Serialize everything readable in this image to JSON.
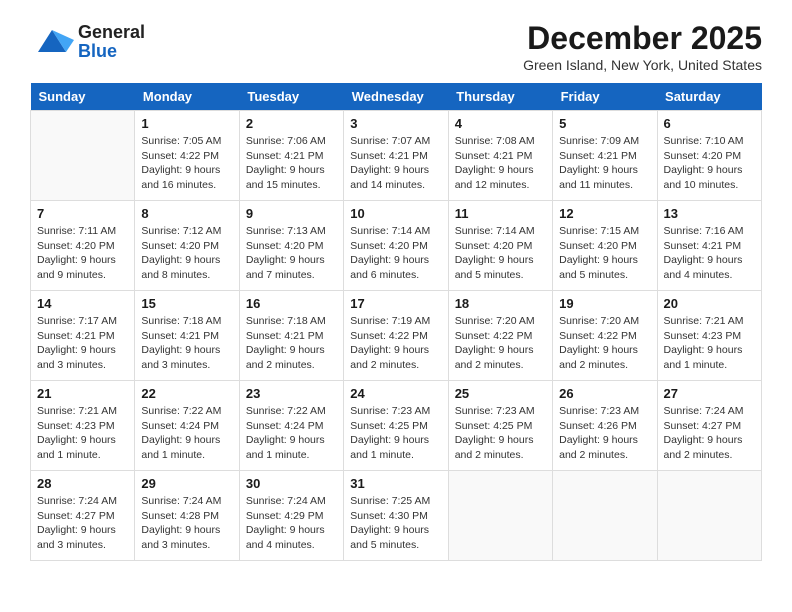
{
  "header": {
    "logo_general": "General",
    "logo_blue": "Blue",
    "month_title": "December 2025",
    "location": "Green Island, New York, United States"
  },
  "weekdays": [
    "Sunday",
    "Monday",
    "Tuesday",
    "Wednesday",
    "Thursday",
    "Friday",
    "Saturday"
  ],
  "weeks": [
    [
      {
        "day": "",
        "info": ""
      },
      {
        "day": "1",
        "info": "Sunrise: 7:05 AM\nSunset: 4:22 PM\nDaylight: 9 hours\nand 16 minutes."
      },
      {
        "day": "2",
        "info": "Sunrise: 7:06 AM\nSunset: 4:21 PM\nDaylight: 9 hours\nand 15 minutes."
      },
      {
        "day": "3",
        "info": "Sunrise: 7:07 AM\nSunset: 4:21 PM\nDaylight: 9 hours\nand 14 minutes."
      },
      {
        "day": "4",
        "info": "Sunrise: 7:08 AM\nSunset: 4:21 PM\nDaylight: 9 hours\nand 12 minutes."
      },
      {
        "day": "5",
        "info": "Sunrise: 7:09 AM\nSunset: 4:21 PM\nDaylight: 9 hours\nand 11 minutes."
      },
      {
        "day": "6",
        "info": "Sunrise: 7:10 AM\nSunset: 4:20 PM\nDaylight: 9 hours\nand 10 minutes."
      }
    ],
    [
      {
        "day": "7",
        "info": "Sunrise: 7:11 AM\nSunset: 4:20 PM\nDaylight: 9 hours\nand 9 minutes."
      },
      {
        "day": "8",
        "info": "Sunrise: 7:12 AM\nSunset: 4:20 PM\nDaylight: 9 hours\nand 8 minutes."
      },
      {
        "day": "9",
        "info": "Sunrise: 7:13 AM\nSunset: 4:20 PM\nDaylight: 9 hours\nand 7 minutes."
      },
      {
        "day": "10",
        "info": "Sunrise: 7:14 AM\nSunset: 4:20 PM\nDaylight: 9 hours\nand 6 minutes."
      },
      {
        "day": "11",
        "info": "Sunrise: 7:14 AM\nSunset: 4:20 PM\nDaylight: 9 hours\nand 5 minutes."
      },
      {
        "day": "12",
        "info": "Sunrise: 7:15 AM\nSunset: 4:20 PM\nDaylight: 9 hours\nand 5 minutes."
      },
      {
        "day": "13",
        "info": "Sunrise: 7:16 AM\nSunset: 4:21 PM\nDaylight: 9 hours\nand 4 minutes."
      }
    ],
    [
      {
        "day": "14",
        "info": "Sunrise: 7:17 AM\nSunset: 4:21 PM\nDaylight: 9 hours\nand 3 minutes."
      },
      {
        "day": "15",
        "info": "Sunrise: 7:18 AM\nSunset: 4:21 PM\nDaylight: 9 hours\nand 3 minutes."
      },
      {
        "day": "16",
        "info": "Sunrise: 7:18 AM\nSunset: 4:21 PM\nDaylight: 9 hours\nand 2 minutes."
      },
      {
        "day": "17",
        "info": "Sunrise: 7:19 AM\nSunset: 4:22 PM\nDaylight: 9 hours\nand 2 minutes."
      },
      {
        "day": "18",
        "info": "Sunrise: 7:20 AM\nSunset: 4:22 PM\nDaylight: 9 hours\nand 2 minutes."
      },
      {
        "day": "19",
        "info": "Sunrise: 7:20 AM\nSunset: 4:22 PM\nDaylight: 9 hours\nand 2 minutes."
      },
      {
        "day": "20",
        "info": "Sunrise: 7:21 AM\nSunset: 4:23 PM\nDaylight: 9 hours\nand 1 minute."
      }
    ],
    [
      {
        "day": "21",
        "info": "Sunrise: 7:21 AM\nSunset: 4:23 PM\nDaylight: 9 hours\nand 1 minute."
      },
      {
        "day": "22",
        "info": "Sunrise: 7:22 AM\nSunset: 4:24 PM\nDaylight: 9 hours\nand 1 minute."
      },
      {
        "day": "23",
        "info": "Sunrise: 7:22 AM\nSunset: 4:24 PM\nDaylight: 9 hours\nand 1 minute."
      },
      {
        "day": "24",
        "info": "Sunrise: 7:23 AM\nSunset: 4:25 PM\nDaylight: 9 hours\nand 1 minute."
      },
      {
        "day": "25",
        "info": "Sunrise: 7:23 AM\nSunset: 4:25 PM\nDaylight: 9 hours\nand 2 minutes."
      },
      {
        "day": "26",
        "info": "Sunrise: 7:23 AM\nSunset: 4:26 PM\nDaylight: 9 hours\nand 2 minutes."
      },
      {
        "day": "27",
        "info": "Sunrise: 7:24 AM\nSunset: 4:27 PM\nDaylight: 9 hours\nand 2 minutes."
      }
    ],
    [
      {
        "day": "28",
        "info": "Sunrise: 7:24 AM\nSunset: 4:27 PM\nDaylight: 9 hours\nand 3 minutes."
      },
      {
        "day": "29",
        "info": "Sunrise: 7:24 AM\nSunset: 4:28 PM\nDaylight: 9 hours\nand 3 minutes."
      },
      {
        "day": "30",
        "info": "Sunrise: 7:24 AM\nSunset: 4:29 PM\nDaylight: 9 hours\nand 4 minutes."
      },
      {
        "day": "31",
        "info": "Sunrise: 7:25 AM\nSunset: 4:30 PM\nDaylight: 9 hours\nand 5 minutes."
      },
      {
        "day": "",
        "info": ""
      },
      {
        "day": "",
        "info": ""
      },
      {
        "day": "",
        "info": ""
      }
    ]
  ]
}
